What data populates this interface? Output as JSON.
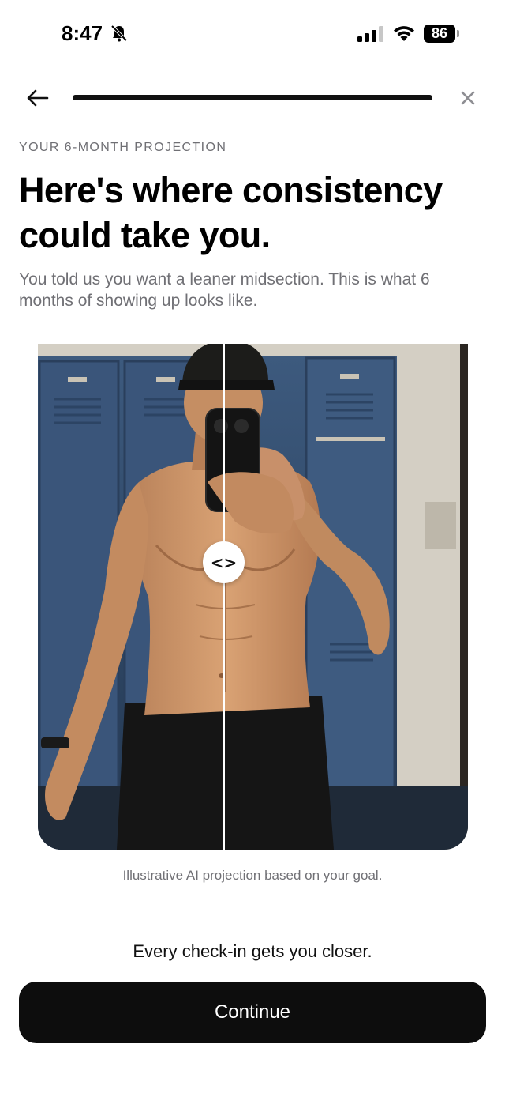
{
  "status_bar": {
    "time": "8:47",
    "battery": "86"
  },
  "nav": {
    "progress_fraction": 1.0
  },
  "content": {
    "eyebrow": "YOUR 6-MONTH PROJECTION",
    "headline": "Here's where consistency could take you.",
    "subtext": "You told us you want a leaner midsection. This is what 6 months of showing up looks like.",
    "compare_handle_label": "<>",
    "caption": "Illustrative AI projection based on your goal.",
    "tagline": "Every check-in gets you closer.",
    "continue_label": "Continue"
  },
  "icons": {
    "back": "arrow-left-icon",
    "close": "close-icon",
    "mute": "bell-slash-icon",
    "signal": "cellular-signal-icon",
    "wifi": "wifi-icon"
  },
  "colors": {
    "accent": "#0d0d0d",
    "muted_text": "#707075",
    "progress_track": "#e4e4e4"
  }
}
